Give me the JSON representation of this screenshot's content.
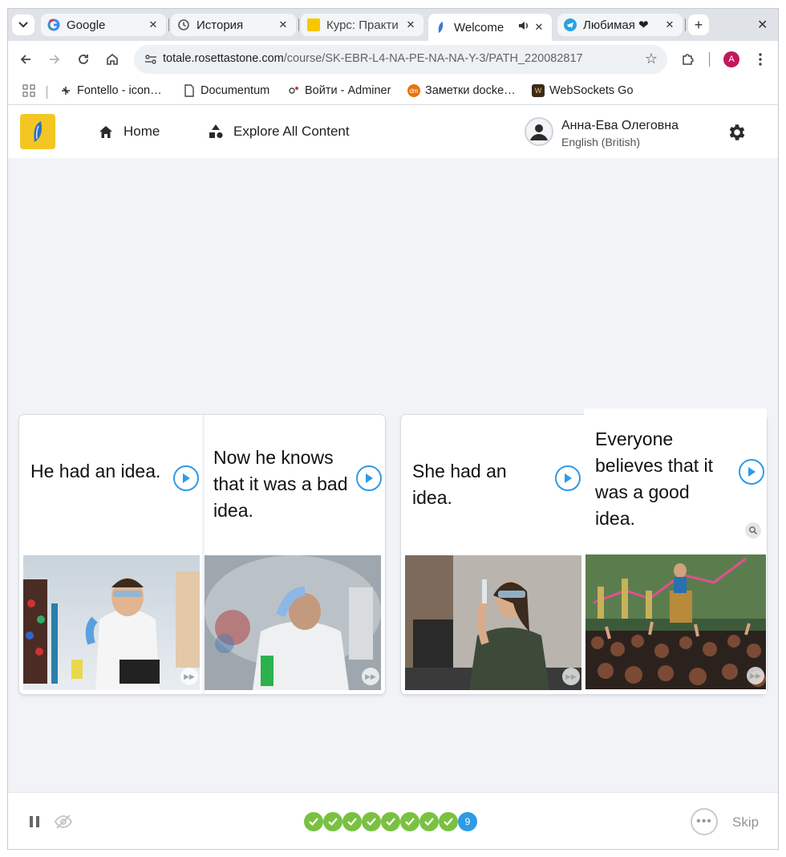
{
  "browser": {
    "tabs": [
      {
        "title": "Google",
        "favicon": "google-icon",
        "state": "inactive"
      },
      {
        "title": "История",
        "favicon": "history-icon",
        "state": "inactive"
      },
      {
        "title": "Курс: Практи",
        "favicon": "yellow-square-icon",
        "state": "inactive"
      },
      {
        "title": "Welcome",
        "favicon": "rosetta-stone-icon",
        "state": "active",
        "audio": "speaker-icon"
      },
      {
        "title": "Любимая ❤",
        "favicon": "telegram-icon",
        "state": "inactive"
      }
    ],
    "url_host": "totale.rosettastone.com",
    "url_path": "/course/SK-EBR-L4-NA-PE-NA-NA-Y-3/PATH_220082817",
    "profile_initial": "A",
    "bookmarks": [
      {
        "label": "Fontello - icon…",
        "icon": "fontello-icon"
      },
      {
        "label": "Documentum",
        "icon": "document-icon"
      },
      {
        "label": "Войти - Adminer",
        "icon": "adminer-icon"
      },
      {
        "label": "Заметки docke…",
        "icon": "dm-icon"
      },
      {
        "label": "WebSockets Go",
        "icon": "websockets-icon"
      }
    ]
  },
  "app": {
    "nav": {
      "home": "Home",
      "explore": "Explore All Content"
    },
    "user": {
      "name": "Анна-Ева Олеговна",
      "language": "English (British)"
    }
  },
  "cards": [
    {
      "panels": [
        {
          "text": "He had an idea.",
          "image": "scientist-laughing-photo"
        },
        {
          "text": "Now he knows that it was a bad idea.",
          "image": "scientist-smoke-photo"
        }
      ]
    },
    {
      "panels": [
        {
          "text": "She had an idea.",
          "image": "woman-scientist-photo"
        },
        {
          "text": "Everyone believes that it was a good idea.",
          "image": "speaker-audience-photo"
        }
      ]
    }
  ],
  "progress": {
    "completed": 8,
    "current": "9"
  },
  "footer": {
    "skip_label": "Skip"
  },
  "colors": {
    "accent_blue": "#2f9ae5",
    "progress_green": "#7ac142",
    "logo_yellow": "#f3c623"
  }
}
